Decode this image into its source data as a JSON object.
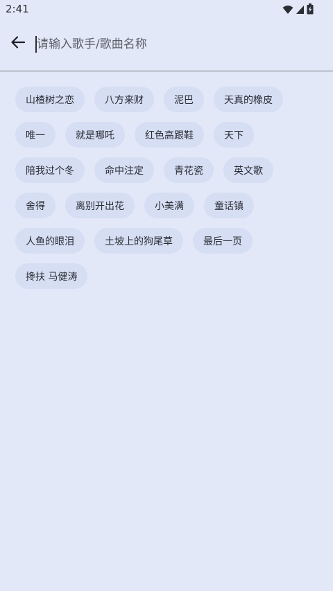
{
  "status_bar": {
    "time": "2:41",
    "icons": [
      "wifi-icon",
      "cell-signal-icon",
      "battery-charging-icon"
    ]
  },
  "search": {
    "placeholder": "请输入歌手/歌曲名称",
    "value": ""
  },
  "history_tags": [
    "山楂树之恋",
    "八方来财",
    "泥巴",
    "天真的橡皮",
    "唯一",
    "就是哪吒",
    "红色高跟鞋",
    "天下",
    "陪我过个冬",
    "命中注定",
    "青花瓷",
    "英文歌",
    "舍得",
    "离别开出花",
    "小美满",
    "童话镇",
    "人鱼的眼泪",
    "土坡上的狗尾草",
    "最后一页",
    "搀扶 马健涛"
  ],
  "colors": {
    "background": "#e2e8f7",
    "chip": "#d6def4",
    "text": "#2a2d33"
  }
}
